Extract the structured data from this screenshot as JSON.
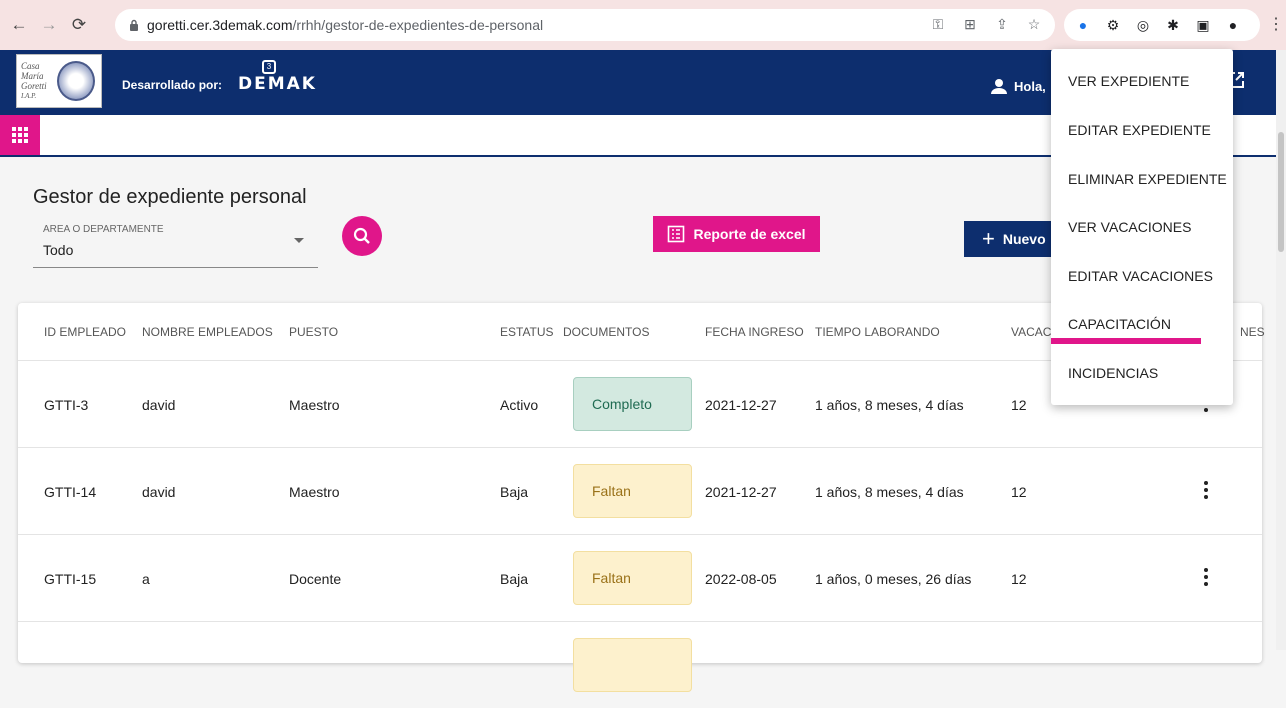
{
  "browser": {
    "url_host": "goretti.cer.3demak.com",
    "url_path": "/rrhh/gestor-de-expedientes-de-personal"
  },
  "header": {
    "logo_text_1": "Casa",
    "logo_text_2": "María",
    "logo_text_3": "Goretti",
    "logo_text_4": "I.A.P.",
    "developed_by": "Desarrollado por:",
    "demak_badge": "3",
    "demak_word": "DEMAK",
    "user_greeting": "Hola,"
  },
  "main": {
    "title": "Gestor de expediente personal",
    "area_label": "AREA O DEPARTAMENTE",
    "area_value": "Todo",
    "excel_label": "Reporte de excel",
    "nuevo_label": "Nuevo"
  },
  "table": {
    "headers": [
      "ID EMPLEADO",
      "NOMBRE EMPLEADOS",
      "PUESTO",
      "ESTATUS",
      "DOCUMENTOS",
      "FECHA INGRESO",
      "TIEMPO LABORANDO",
      "VACACI",
      "NES"
    ],
    "rows": [
      {
        "id": "GTTI-3",
        "nombre": "david",
        "puesto": "Maestro",
        "estatus": "Activo",
        "documentos": "Completo",
        "fecha": "2021-12-27",
        "tiempo": "1 años, 8 meses, 4 días",
        "vacaciones": "12"
      },
      {
        "id": "GTTI-14",
        "nombre": "david",
        "puesto": "Maestro",
        "estatus": "Baja",
        "documentos": "Faltan",
        "fecha": "2021-12-27",
        "tiempo": "1 años, 8 meses, 4 días",
        "vacaciones": "12"
      },
      {
        "id": "GTTI-15",
        "nombre": "a",
        "puesto": "Docente",
        "estatus": "Baja",
        "documentos": "Faltan",
        "fecha": "2022-08-05",
        "tiempo": "1 años, 0 meses, 26 días",
        "vacaciones": "12"
      }
    ]
  },
  "menu": {
    "items": [
      "VER EXPEDIENTE",
      "EDITAR EXPEDIENTE",
      "ELIMINAR EXPEDIENTE",
      "VER VACACIONES",
      "EDITAR VACACIONES",
      "CAPACITACIÓN",
      "INCIDENCIAS"
    ]
  },
  "colors": {
    "navy": "#0d2e6e",
    "magenta": "#e0168a"
  }
}
